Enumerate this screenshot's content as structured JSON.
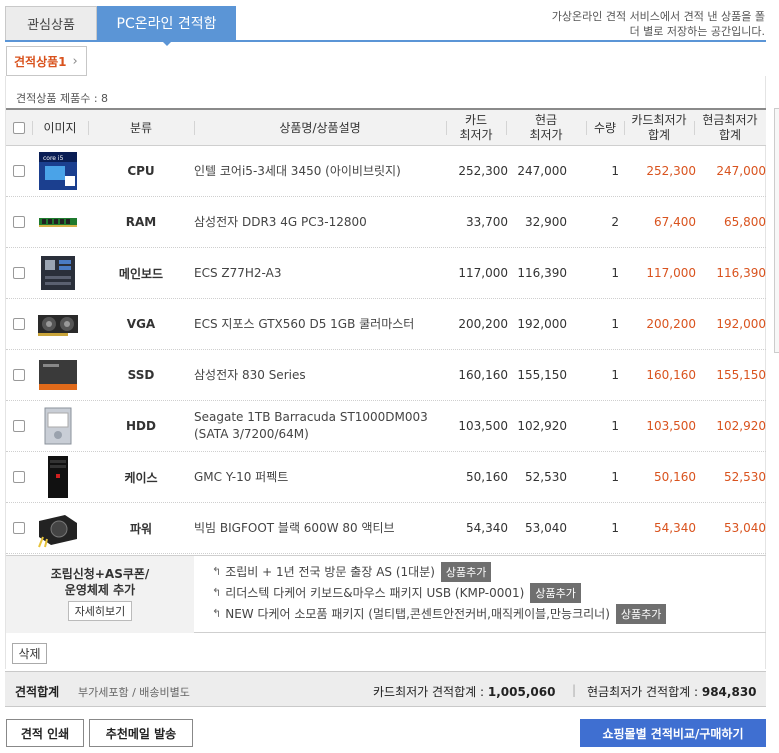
{
  "tabs": [
    {
      "label": "관심상품"
    },
    {
      "label": "PC온라인 견적함"
    }
  ],
  "description": "가상온라인 견적 서비스에서 견적 낸 상품을 폴더 별로 저장하는 공간입니다.",
  "subtab": {
    "label": "견적상품1"
  },
  "product_count": "견적상품 제품수 : 8",
  "columns": {
    "image": "이미지",
    "category": "분류",
    "name": "상품명/상품설명",
    "card_price": "카드\n최저가",
    "cash_price": "현금\n최저가",
    "qty": "수량",
    "card_total": "카드최저가\n합계",
    "cash_total": "현금최저가\n합계"
  },
  "rows": [
    {
      "category": "CPU",
      "name": "인텔 코어i5-3세대 3450 (아이비브릿지)",
      "card": "252,300",
      "cash": "247,000",
      "qty": "1",
      "card_total": "252,300",
      "cash_total": "247,000",
      "icon": "cpu-box-image"
    },
    {
      "category": "RAM",
      "name": "삼성전자 DDR3 4G PC3-12800",
      "card": "33,700",
      "cash": "32,900",
      "qty": "2",
      "card_total": "67,400",
      "cash_total": "65,800",
      "icon": "ram-stick-image"
    },
    {
      "category": "메인보드",
      "name": "ECS Z77H2-A3",
      "card": "117,000",
      "cash": "116,390",
      "qty": "1",
      "card_total": "117,000",
      "cash_total": "116,390",
      "icon": "motherboard-image"
    },
    {
      "category": "VGA",
      "name": "ECS 지포스 GTX560 D5 1GB 쿨러마스터",
      "card": "200,200",
      "cash": "192,000",
      "qty": "1",
      "card_total": "200,200",
      "cash_total": "192,000",
      "icon": "graphics-card-image"
    },
    {
      "category": "SSD",
      "name": "삼성전자 830 Series",
      "card": "160,160",
      "cash": "155,150",
      "qty": "1",
      "card_total": "160,160",
      "cash_total": "155,150",
      "icon": "ssd-image"
    },
    {
      "category": "HDD",
      "name": "Seagate 1TB Barracuda ST1000DM003 (SATA 3/7200/64M)",
      "card": "103,500",
      "cash": "102,920",
      "qty": "1",
      "card_total": "103,500",
      "cash_total": "102,920",
      "icon": "hard-drive-image"
    },
    {
      "category": "케이스",
      "name": "GMC Y-10 퍼펙트",
      "card": "50,160",
      "cash": "52,530",
      "qty": "1",
      "card_total": "50,160",
      "cash_total": "52,530",
      "icon": "pc-case-image"
    },
    {
      "category": "파워",
      "name": "빅빔 BIGFOOT 블랙 600W 80 액티브",
      "card": "54,340",
      "cash": "53,040",
      "qty": "1",
      "card_total": "54,340",
      "cash_total": "53,040",
      "icon": "power-supply-image"
    }
  ],
  "services": {
    "title_line1": "조립신청+AS쿠폰/",
    "title_line2": "운영체제 추가",
    "detail_button": "자세히보기",
    "items": [
      {
        "text": "조립비 + 1년 전국 방문 출장 AS (1대분)",
        "button": "상품추가"
      },
      {
        "text": "리더스텍 다케어 키보드&마우스 패키지 USB (KMP-0001)",
        "button": "상품추가"
      },
      {
        "text": "NEW 다케어 소모품 패키지 (멀티탭,콘센트안전커버,매직케이블,만능크리너)",
        "button": "상품추가"
      }
    ]
  },
  "delete_button": "삭제",
  "total": {
    "label": "견적합계",
    "sub": "부가세포함 / 배송비별도",
    "card_label": "카드최저가 견적합계 : ",
    "card_value": "1,005,060",
    "cash_label": "현금최저가 견적합계 : ",
    "cash_value": "984,830"
  },
  "bottom_buttons": {
    "print": "견적 인쇄",
    "mail": "추천메일 발송",
    "compare": "쇼핑몰별 견적비교/구매하기"
  },
  "colors": {
    "accent": "#5b95d6",
    "orange": "#d9531e",
    "primary_button": "#3f6fd1"
  }
}
